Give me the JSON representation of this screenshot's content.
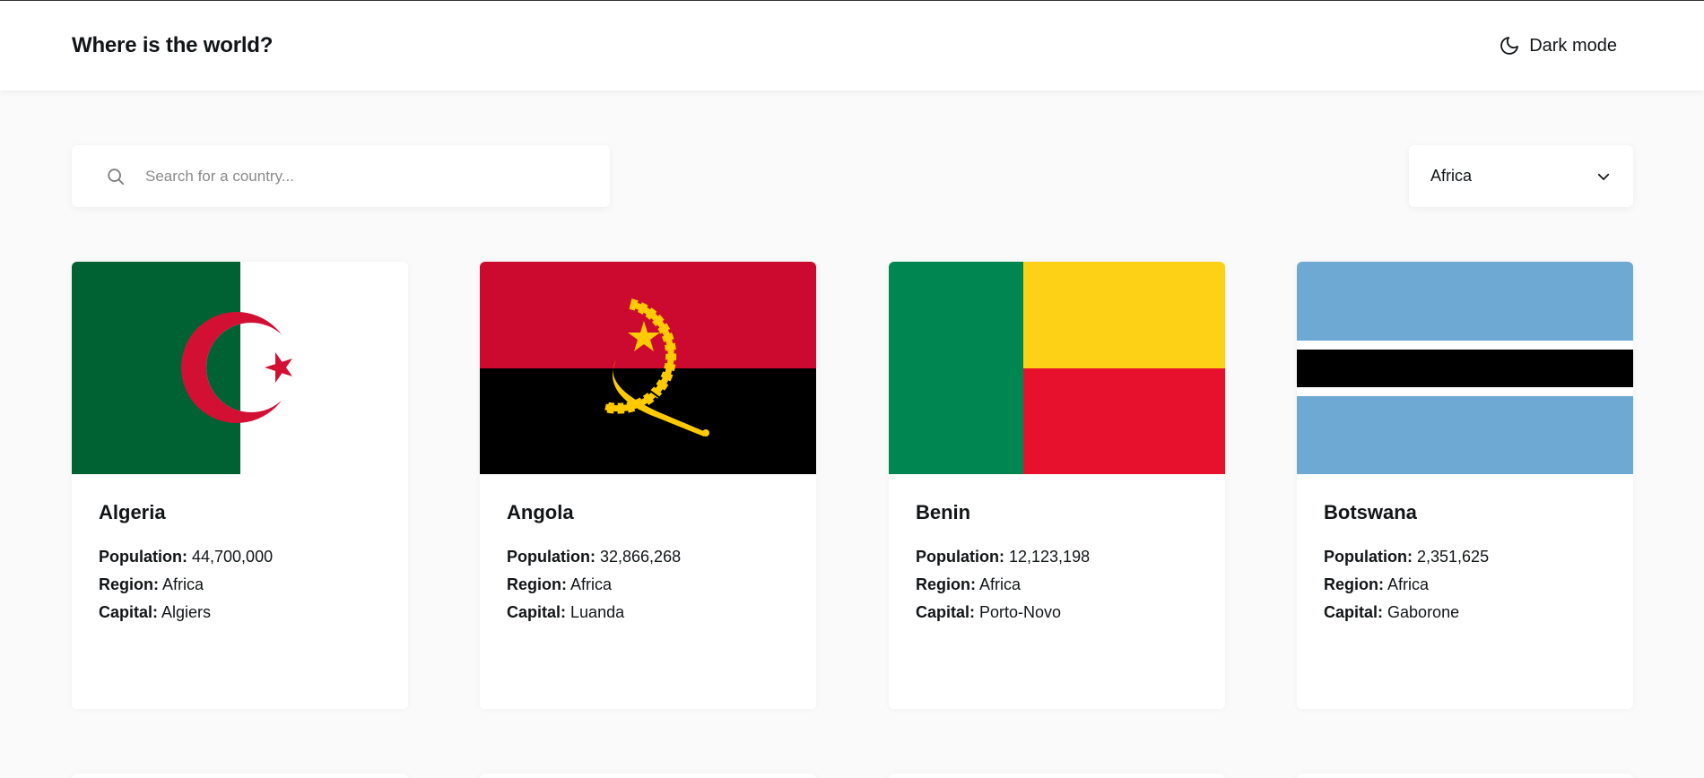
{
  "header": {
    "title": "Where is the world?",
    "theme_toggle_label": "Dark mode",
    "theme_toggle_icon": "moon-icon"
  },
  "search": {
    "placeholder": "Search for a country...",
    "value": "",
    "icon": "search-icon"
  },
  "filter": {
    "selected": "Africa",
    "icon": "chevron-down-icon"
  },
  "labels": {
    "population": "Population:",
    "region": "Region:",
    "capital": "Capital:"
  },
  "countries": [
    {
      "name": "Algeria",
      "population": "44,700,000",
      "region": "Africa",
      "capital": "Algiers",
      "flag": "algeria-flag"
    },
    {
      "name": "Angola",
      "population": "32,866,268",
      "region": "Africa",
      "capital": "Luanda",
      "flag": "angola-flag"
    },
    {
      "name": "Benin",
      "population": "12,123,198",
      "region": "Africa",
      "capital": "Porto-Novo",
      "flag": "benin-flag"
    },
    {
      "name": "Botswana",
      "population": "2,351,625",
      "region": "Africa",
      "capital": "Gaborone",
      "flag": "botswana-flag"
    }
  ],
  "colors": {
    "background": "#fafafa",
    "surface": "#ffffff",
    "text": "#111517"
  }
}
